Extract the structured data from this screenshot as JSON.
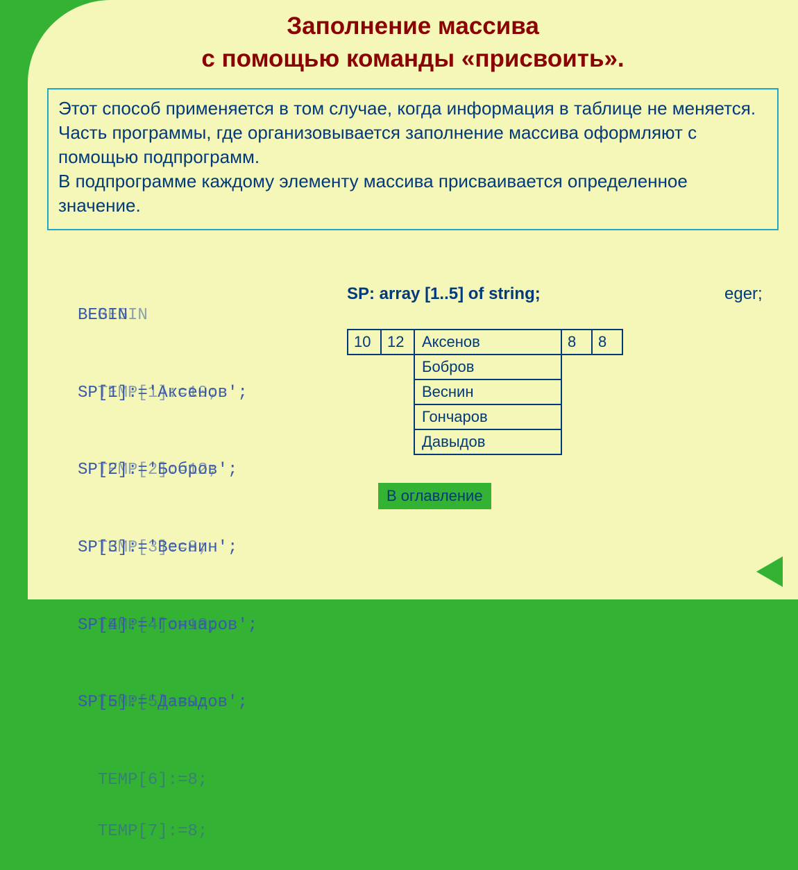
{
  "title_line1": "Заполнение массива",
  "title_line2": "с  помощью команды «присвоить».",
  "info": {
    "p1": "Этот способ применяется в том случае, когда информация в таблице не меняется.",
    "p2": "Часть программы, где организовывается заполнение массива оформляют с помощью подпрограмм.",
    "p3": "В подпрограмме  каждому элементу массива присваивается определенное значение."
  },
  "code_back": [
    "  BEGIN",
    "  TEMP[1]:=10;",
    "  TEMP[2]:=12;",
    "  TEMP[3]:=8;",
    "  TEMP[4]:=10;",
    "  TEMP[5]:=9;",
    "  TEMP[6]:=8;",
    "  TEMP[7]:=8;"
  ],
  "code_front": [
    "BEGIN",
    "SP[1]:='Аксенов';",
    "SP[2]:='Бобров';",
    "SP[3]:='Веснин';",
    "SP[4]:='Гончаров';",
    "SP[5]:='Давыдов';",
    "",
    ""
  ],
  "declaration": "SP:  array [1..5] of string;",
  "declaration_tail": "eger;",
  "num_cells_left": [
    "10",
    "12"
  ],
  "num_cells_right": [
    "8",
    "8"
  ],
  "names": [
    "Аксенов",
    "Бобров",
    "Веснин",
    "Гончаров",
    "Давыдов"
  ],
  "toc_label": "В оглавление"
}
